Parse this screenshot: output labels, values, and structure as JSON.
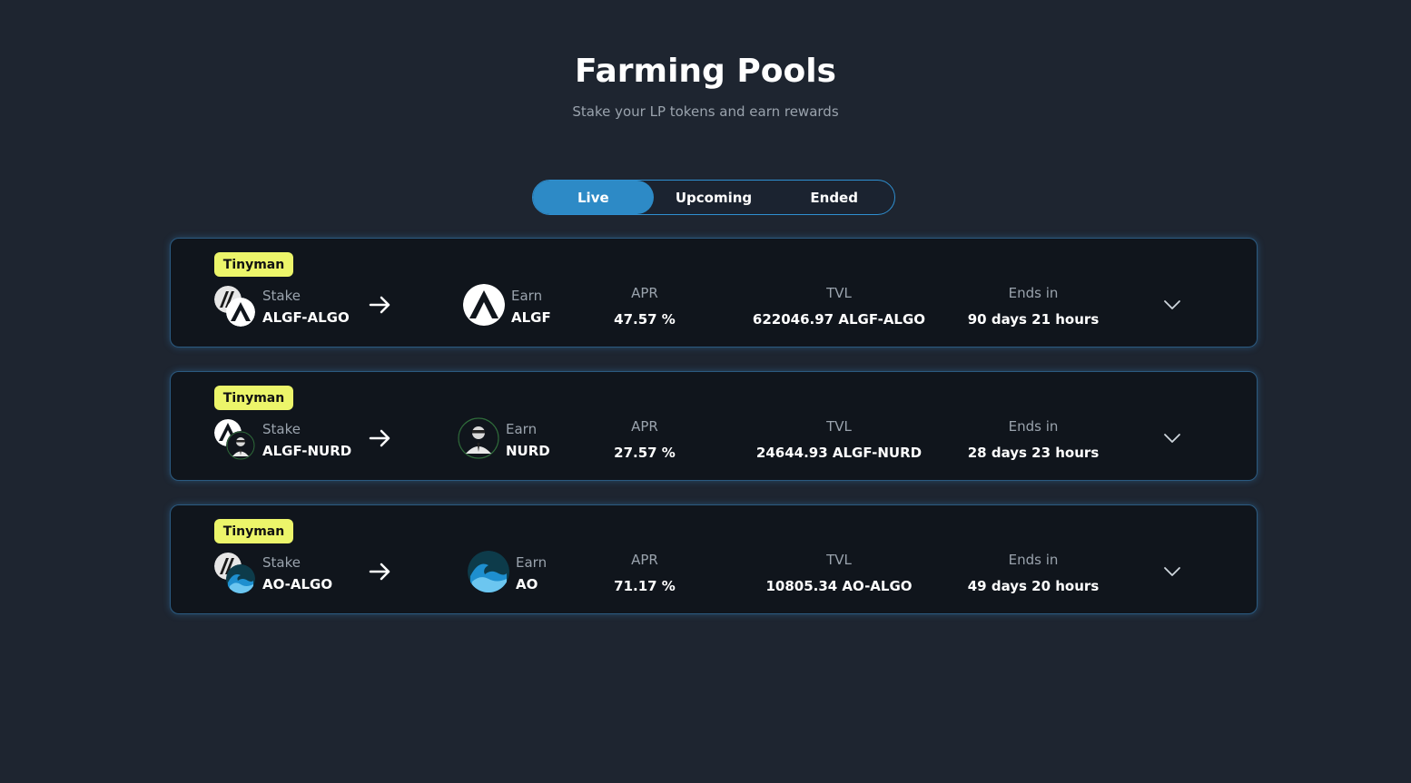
{
  "header": {
    "title": "Farming Pools",
    "subtitle": "Stake your LP tokens and earn rewards"
  },
  "tabs": [
    {
      "label": "Live",
      "active": true
    },
    {
      "label": "Upcoming",
      "active": false
    },
    {
      "label": "Ended",
      "active": false
    }
  ],
  "colors": {
    "accent": "#2d8ac6",
    "badge": "#ecf56a",
    "background": "#1e2530",
    "card": "#10151c"
  },
  "labels": {
    "stake": "Stake",
    "earn": "Earn",
    "apr": "APR",
    "tvl": "TVL",
    "ends_in": "Ends in"
  },
  "pools": [
    {
      "badge": "Tinyman",
      "stake_token": "ALGF-ALGO",
      "stake_icons": [
        "algofi-icon",
        "algofi-icon"
      ],
      "earn_token": "ALGF",
      "earn_icon": "algofi-icon",
      "apr": "47.57 %",
      "tvl": "622046.97 ALGF-ALGO",
      "ends_in": "90 days 21 hours"
    },
    {
      "badge": "Tinyman",
      "stake_token": "ALGF-NURD",
      "stake_icons": [
        "algofi-icon",
        "nurd-icon"
      ],
      "earn_token": "NURD",
      "earn_icon": "nurd-icon",
      "apr": "27.57 %",
      "tvl": "24644.93 ALGF-NURD",
      "ends_in": "28 days 23 hours"
    },
    {
      "badge": "Tinyman",
      "stake_token": "AO-ALGO",
      "stake_icons": [
        "algofi-icon",
        "wave-icon"
      ],
      "earn_token": "AO",
      "earn_icon": "wave-icon",
      "apr": "71.17 %",
      "tvl": "10805.34 AO-ALGO",
      "ends_in": "49 days 20 hours"
    }
  ]
}
